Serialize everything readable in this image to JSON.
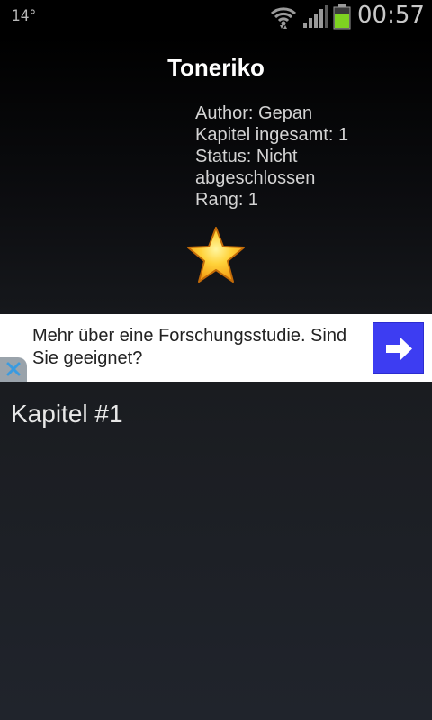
{
  "status_bar": {
    "temperature": "14°",
    "time": "00:57",
    "icons": [
      "wifi-icon",
      "signal-icon",
      "battery-icon"
    ],
    "battery_color": "#7ed321"
  },
  "manga": {
    "title": "Toneriko",
    "author": "Author: Gepan",
    "chapters_total": "Kapitel ingesamt: 1",
    "status": "Status: Nicht abgeschlossen",
    "rank": "Rang: 1",
    "favorite_icon": "star-icon"
  },
  "ad": {
    "text": "Mehr über eine Forschungsstudie. Sind Sie geeignet?",
    "action_icon": "arrow-right-icon",
    "close_icon": "close-icon",
    "accent": "#3d3df2"
  },
  "chapters": [
    {
      "label": "Kapitel #1"
    }
  ]
}
